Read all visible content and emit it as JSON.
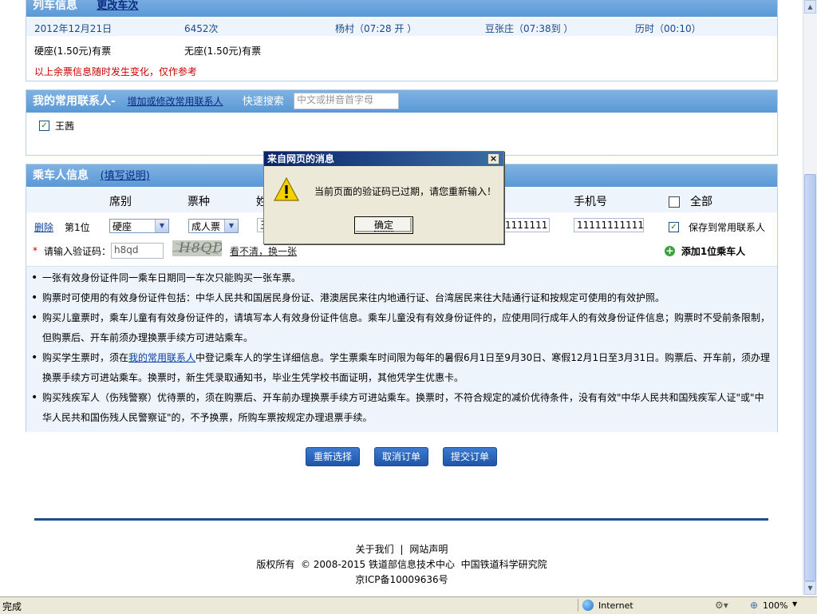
{
  "train_info": {
    "title": "列车信息",
    "change_link": "更改车次",
    "date": "2012年12月21日",
    "train_no": "6452次",
    "from": "杨村（07:28 开 ）",
    "to": "豆张庄（07:38到 ）",
    "duration": "历时（00:10）",
    "seat_hard": "硬座(1.50元)有票",
    "seat_none": "无座(1.50元)有票",
    "notice": "以上余票信息随时发生变化，仅作参考"
  },
  "contacts": {
    "title": "我的常用联系人",
    "dash": "-",
    "edit_link": "增加或修改常用联系人",
    "quick_search": "快速搜索",
    "search_placeholder": "中文或拼音首字母",
    "items": [
      {
        "name": "王茜",
        "checked": true
      }
    ]
  },
  "passenger": {
    "title": "乘车人信息",
    "help_link": "(填写说明)",
    "headers": {
      "seat": "席别",
      "ticket_type": "票种",
      "name_partial": "姓",
      "phone": "手机号",
      "all": "全部"
    },
    "row": {
      "delete": "删除",
      "position": "第1位",
      "seat": "硬座",
      "ticket_type": "成人票",
      "name_partial": "王",
      "id_partial": "1111111",
      "phone": "11111111111",
      "save_label": "保存到常用联系人"
    },
    "captcha_label": "请输入验证码：",
    "captcha_value": "h8qd",
    "captcha_image_text": "H8QD",
    "captcha_refresh": "看不清，换一张",
    "add_passenger": "添加1位乘车人"
  },
  "notes": [
    "一张有效身份证件同一乘车日期同一车次只能购买一张车票。",
    "购票时可使用的有效身份证件包括：中华人民共和国居民身份证、港澳居民来往内地通行证、台湾居民来往大陆通行证和按规定可使用的有效护照。",
    "购买儿童票时，乘车儿童有有效身份证件的，请填写本人有效身份证件信息。乘车儿童没有有效身份证件的，应使用同行成年人的有效身份证件信息；购票时不受前条限制，但购票后、开车前须办理换票手续方可进站乘车。",
    "购买学生票时，须在|我的常用联系人|中登记乘车人的学生详细信息。学生票乘车时间限为每年的暑假6月1日至9月30日、寒假12月1日至3月31日。购票后、开车前，须办理换票手续方可进站乘车。换票时，新生凭录取通知书，毕业生凭学校书面证明，其他凭学生优惠卡。",
    "购买残疾军人（伤残警察）优待票的，须在购票后、开车前办理换票手续方可进站乘车。换票时，不符合规定的减价优待条件，没有有效\"中华人民共和国残疾军人证\"或\"中华人民共和国伤残人民警察证\"的，不予换票，所购车票按规定办理退票手续。"
  ],
  "note4_parts": {
    "before": "购买学生票时，须在",
    "link": "我的常用联系人",
    "after": "中登记乘车人的学生详细信息。学生票乘车时间限为每年的暑假6月1日至9月30日、寒假12月1日至3月31日。购票后、开车前，须办理换票手续方可进站乘车。换票时，新生凭录取通知书，毕业生凭学校书面证明，其他凭学生优惠卡。"
  },
  "buttons": {
    "reselect": "重新选择",
    "cancel": "取消订单",
    "submit": "提交订单"
  },
  "footer": {
    "about": "关于我们",
    "sep": "|",
    "statement": "网站声明",
    "copyright": "版权所有  © 2008-2015 铁道部信息技术中心  中国铁道科学研究院",
    "icp": "京ICP备10009636号"
  },
  "dialog": {
    "title": "来自网页的消息",
    "message": "当前页面的验证码已过期，请您重新输入！",
    "ok": "确定",
    "close": "×"
  },
  "statusbar": {
    "status": "完成",
    "zone": "Internet",
    "zoom": "100%"
  }
}
